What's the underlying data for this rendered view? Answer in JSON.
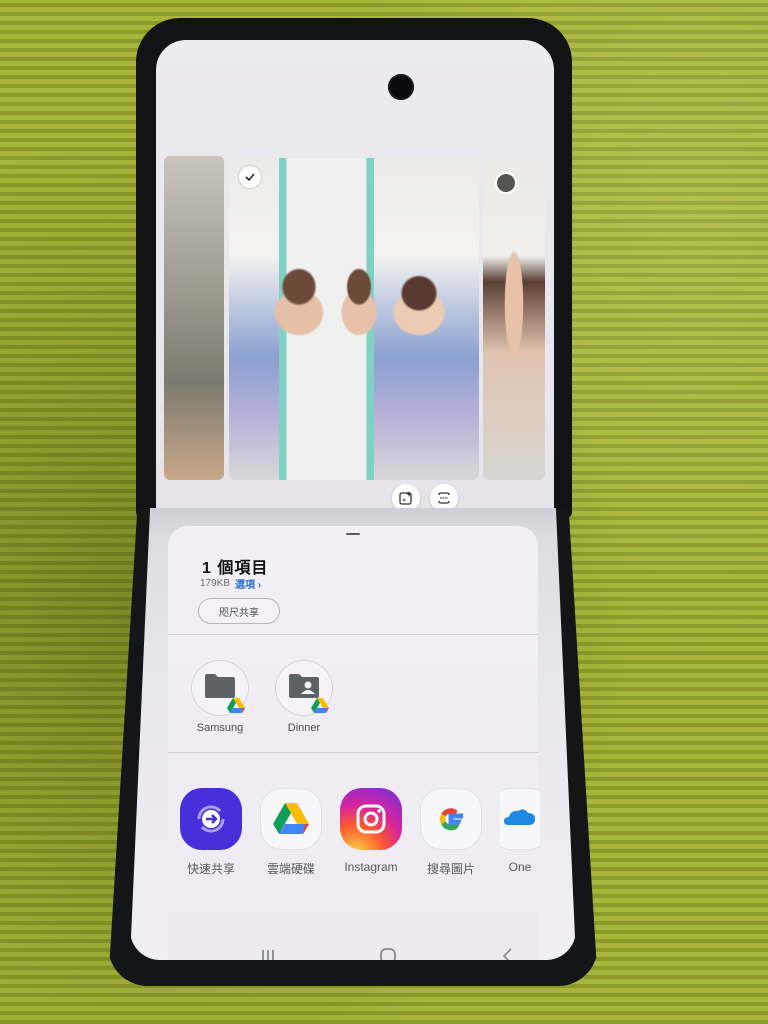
{
  "gallery": {
    "current_selected": true,
    "next_selected": false
  },
  "share_sheet": {
    "title": "1 個項目",
    "size": "179KB",
    "options_link": "選項",
    "options_chevron": "›",
    "nearby_share_label": "咫尺共享",
    "direct_share": [
      {
        "label": "Samsung",
        "icon": "folder-icon",
        "badge": "google-drive-icon"
      },
      {
        "label": "Dinner",
        "icon": "shared-folder-icon",
        "badge": "google-drive-icon"
      }
    ],
    "apps": [
      {
        "label": "快速共享",
        "icon": "quick-share-icon"
      },
      {
        "label": "雲端硬碟",
        "icon": "google-drive-icon"
      },
      {
        "label": "Instagram",
        "icon": "instagram-icon"
      },
      {
        "label": "搜尋圖片",
        "icon": "google-icon"
      },
      {
        "label": "One",
        "icon": "onedrive-icon"
      }
    ]
  },
  "nav": {
    "recents": "recents-icon",
    "home": "home-icon",
    "back": "back-icon"
  },
  "colors": {
    "accent_link": "#2d6fd9",
    "quick_share": "#4530d9"
  }
}
